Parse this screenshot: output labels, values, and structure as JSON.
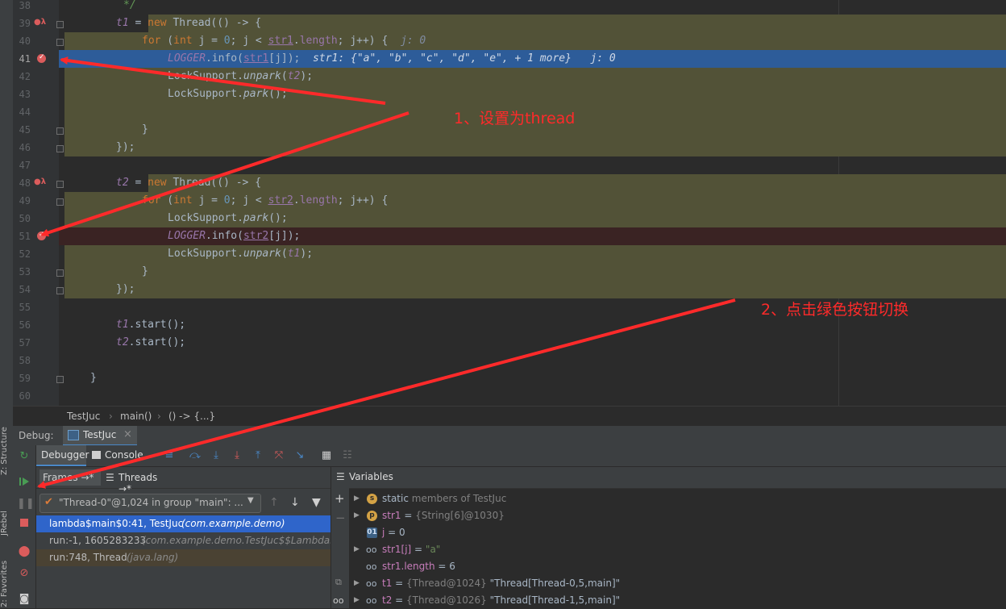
{
  "editor": {
    "lines": [
      {
        "n": "38"
      },
      {
        "n": "39"
      },
      {
        "n": "40"
      },
      {
        "n": "41"
      },
      {
        "n": "42"
      },
      {
        "n": "43"
      },
      {
        "n": "44"
      },
      {
        "n": "45"
      },
      {
        "n": "46"
      },
      {
        "n": "47"
      },
      {
        "n": "48"
      },
      {
        "n": "49"
      },
      {
        "n": "50"
      },
      {
        "n": "51"
      },
      {
        "n": "52"
      },
      {
        "n": "53"
      },
      {
        "n": "54"
      },
      {
        "n": "55"
      },
      {
        "n": "56"
      },
      {
        "n": "57"
      },
      {
        "n": "58"
      },
      {
        "n": "59"
      },
      {
        "n": "60"
      }
    ],
    "code": {
      "l38": "*/",
      "l39_var": "t1",
      "l39_eq": " = ",
      "l39_new": "new",
      "l39_rest": " Thread(() -> {",
      "l40_for": "for",
      "l40_a": " (",
      "l40_int": "int",
      "l40_b": " j = ",
      "l40_zero": "0",
      "l40_c": "; j < ",
      "l40_fld": "str1",
      "l40_d": ".",
      "l40_len": "length",
      "l40_e": "; j++) {",
      "l40_hint": "j: 0",
      "l41_logger": "LOGGER",
      "l41_a": ".info(",
      "l41_fld": "str1",
      "l41_b": "[j]);",
      "l41_hint": "str1: {\"a\", \"b\", \"c\", \"d\", \"e\", + 1 more}   j: 0",
      "l42_a": "LockSupport.",
      "l42_fn": "unpark",
      "l42_b": "(",
      "l42_arg": "t2",
      "l42_c": ");",
      "l43_a": "LockSupport.",
      "l43_fn": "park",
      "l43_b": "();",
      "l45": "}",
      "l46": "});",
      "l48_var": "t2",
      "l48_eq": " = ",
      "l48_new": "new",
      "l48_rest": " Thread(() -> {",
      "l49_for": "for",
      "l49_a": " (",
      "l49_int": "int",
      "l49_b": " j = ",
      "l49_zero": "0",
      "l49_c": "; j < ",
      "l49_fld": "str2",
      "l49_d": ".",
      "l49_len": "length",
      "l49_e": "; j++) {",
      "l50_a": "LockSupport.",
      "l50_fn": "park",
      "l50_b": "();",
      "l51_logger": "LOGGER",
      "l51_a": ".info(",
      "l51_fld": "str2",
      "l51_b": "[j]);",
      "l52_a": "LockSupport.",
      "l52_fn": "unpark",
      "l52_b": "(",
      "l52_arg": "t1",
      "l52_c": ");",
      "l53": "}",
      "l54": "});",
      "l56_var": "t1",
      "l56_rest": ".start();",
      "l57_var": "t2",
      "l57_rest": ".start();",
      "l59": "}"
    }
  },
  "breadcrumb": {
    "items": [
      "TestJuc",
      "main()",
      "() -> {...}"
    ],
    "sep": "›"
  },
  "debug": {
    "title": "Debug:",
    "session_tab": "TestJuc",
    "close": "×",
    "tabs": {
      "debugger": "Debugger",
      "console": "Console"
    },
    "frames_tab": "Frames →*",
    "threads_tab": "Threads →*",
    "thread_select": "\"Thread-0\"@1,024 in group \"main\": ...",
    "frames": [
      {
        "method": "lambda$main$0:41, TestJuc",
        "pkg": "(com.example.demo)"
      },
      {
        "method": "run:-1, 1605283233",
        "pkg": "(com.example.demo.TestJuc$$Lambda$"
      },
      {
        "method": "run:748, Thread",
        "pkg": "(java.lang)"
      }
    ],
    "variables_title": "Variables",
    "variables": [
      {
        "prefix": "static",
        "name": "members of TestJuc",
        "value": ""
      },
      {
        "name": "str1",
        "eq": " = ",
        "type": "{String[6]@1030}",
        "value": ""
      },
      {
        "name": "j",
        "eq": " = ",
        "type": "",
        "value": "0"
      },
      {
        "name": "str1[j]",
        "eq": " = ",
        "type": "",
        "value": "\"a\""
      },
      {
        "name": "str1.length",
        "eq": " = ",
        "type": "",
        "value": "6"
      },
      {
        "name": "t1",
        "eq": " = ",
        "type": "{Thread@1024}",
        "value": "\"Thread[Thread-0,5,main]\""
      },
      {
        "name": "t2",
        "eq": " = ",
        "type": "{Thread@1026}",
        "value": "\"Thread[Thread-1,5,main]\""
      }
    ]
  },
  "side_tabs": {
    "structure": "Z: Structure",
    "jrebel": "JRebel",
    "favorites": "2: Favorites"
  },
  "annotations": {
    "step1": "1、设置为thread",
    "step2": "2、点击绿色按钮切换"
  },
  "colors": {
    "arrow": "#ff2a2a",
    "breakpoint": "#db5c5c",
    "current_line": "#2d5c99",
    "lambda_bg": "#525237",
    "resume_green": "#499c54"
  }
}
